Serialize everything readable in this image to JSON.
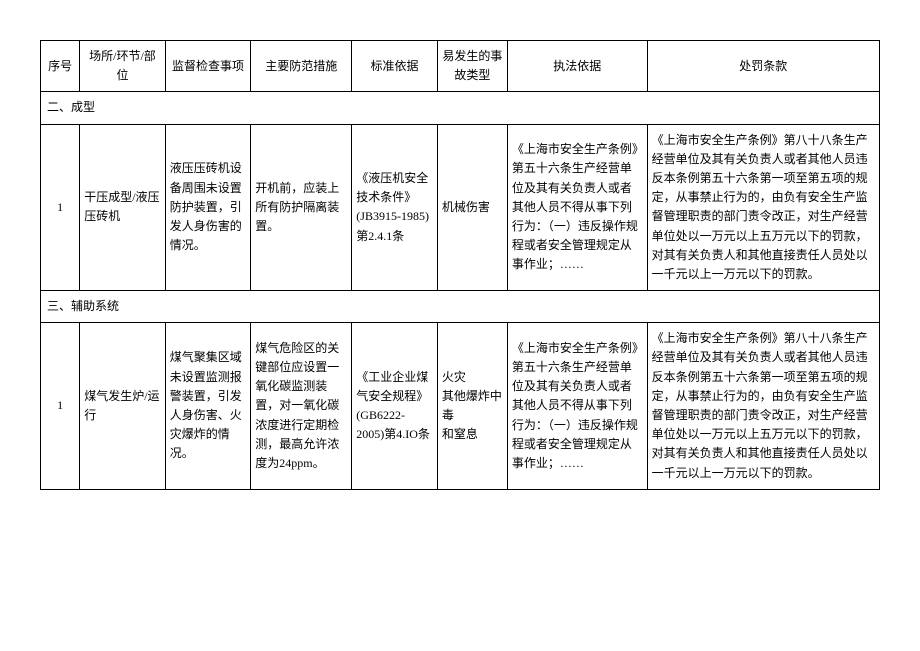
{
  "headers": {
    "num": "序号",
    "place": "场所/环节/部位",
    "inspect": "监督检查事项",
    "measure": "主要防范措施",
    "standard": "标准依据",
    "accident": "易发生的事故类型",
    "legal": "执法依据",
    "penalty": "处罚条款"
  },
  "sections": [
    {
      "title": "二、成型",
      "rows": [
        {
          "num": "1",
          "place": "干压成型/液压压砖机",
          "inspect": "液压压砖机设备周围未设置防护装置，引发人身伤害的情况。",
          "measure": "开机前，应装上所有防护隔离装置。",
          "standard": "《液压机安全技术条件》(JB3915-1985)第2.4.1条",
          "accident": "机械伤害",
          "legal": "《上海市安全生产条例》第五十六条生产经营单位及其有关负责人或者其他人员不得从事下列行为：（一）违反操作规程或者安全管理规定从事作业；……",
          "penalty": "《上海市安全生产条例》第八十八条生产经营单位及其有关负责人或者其他人员违反本条例第五十六条第一项至第五项的规定，从事禁止行为的，由负有安全生产监督管理职责的部门责令改正，对生产经营单位处以一万元以上五万元以下的罚款，对其有关负责人和其他直接责任人员处以一千元以上一万元以下的罚款。"
        }
      ]
    },
    {
      "title": "三、辅助系统",
      "rows": [
        {
          "num": "1",
          "place": "煤气发生炉/运行",
          "inspect": "煤气聚集区域未设置监测报警装置，引发人身伤害、火灾爆炸的情况。",
          "measure": "煤气危险区的关键部位应设置一氧化碳监测装置，对一氧化碳浓度进行定期检测，最高允许浓度为24ppm。",
          "standard": "《工业企业煤气安全规程》(GB6222-2005)第4.IO条",
          "accident": "火灾\n其他爆炸中毒\n和窒息",
          "legal": "《上海市安全生产条例》第五十六条生产经营单位及其有关负责人或者其他人员不得从事下列行为：（一）违反操作规程或者安全管理规定从事作业；……",
          "penalty": "《上海市安全生产条例》第八十八条生产经营单位及其有关负责人或者其他人员违反本条例第五十六条第一项至第五项的规定，从事禁止行为的，由负有安全生产监督管理职责的部门责令改正，对生产经营单位处以一万元以上五万元以下的罚款，对其有关负责人和其他直接责任人员处以一千元以上一万元以下的罚款。"
        }
      ]
    }
  ]
}
